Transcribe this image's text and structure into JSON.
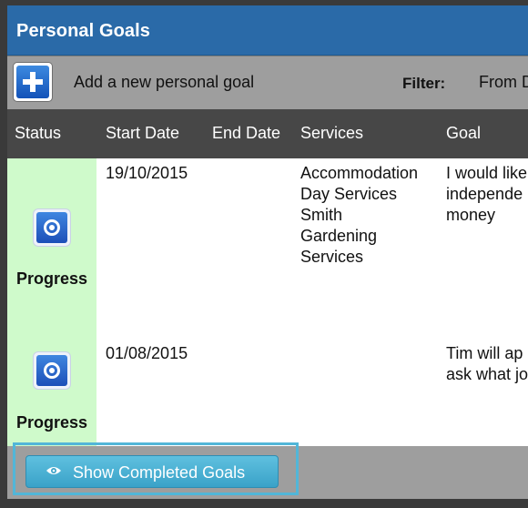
{
  "panel": {
    "title": "Personal Goals"
  },
  "toolbar": {
    "add_label": "Add a new personal goal",
    "filter_label": "Filter:",
    "from_label": "From D"
  },
  "table": {
    "headers": [
      "Status",
      "Start Date",
      "End Date",
      "Services",
      "Goal"
    ],
    "rows": [
      {
        "status": "Progress",
        "status_icon": "target-icon",
        "start_date": "19/10/2015",
        "end_date": "",
        "services": [
          "Accommodation",
          "Day Services",
          "Smith",
          "Gardening",
          "Services"
        ],
        "goal": [
          "I would like",
          "independe",
          "money"
        ]
      },
      {
        "status": "Progress",
        "status_icon": "target-icon",
        "start_date": "01/08/2015",
        "end_date": "",
        "services": [],
        "goal": [
          "Tim will ap",
          "ask what jo"
        ]
      }
    ]
  },
  "footer": {
    "show_completed_label": "Show Completed Goals",
    "icon": "eye-icon"
  },
  "colors": {
    "title_bar": "#2a6aa8",
    "status_cell": "#cffacb",
    "button": "#3aa2c8",
    "header_row": "#474747"
  }
}
